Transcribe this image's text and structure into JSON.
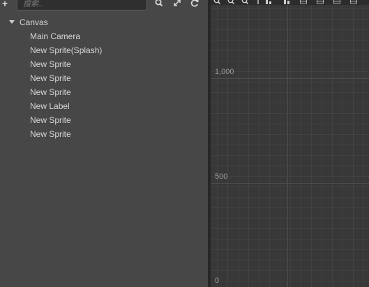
{
  "hierarchy": {
    "search_placeholder": "搜索..",
    "tree": {
      "root": "Canvas",
      "children": [
        "Main Camera",
        "New Sprite(Splash)",
        "New Sprite",
        "New Sprite",
        "New Sprite",
        "New Label",
        "New Sprite",
        "New Sprite"
      ]
    },
    "icons": {
      "add": "plus-icon",
      "search": "search-icon",
      "expand": "expand-arrows-icon",
      "refresh": "refresh-icon"
    }
  },
  "scene": {
    "y_axis_labels": [
      "1,000",
      "500",
      "0"
    ],
    "toolbar_icons": [
      "zoom-out-icon",
      "zoom-reset-icon",
      "zoom-in-icon",
      "pivot-icon",
      "align-top-icon",
      "align-vcenter-icon",
      "align-bottom-icon",
      "align-left-icon",
      "align-hcenter-icon",
      "align-right-icon"
    ]
  },
  "colors": {
    "panel_bg": "#474747",
    "scene_bg": "#383838",
    "text": "#d6d6d6",
    "axis_label": "#9c9c9c"
  }
}
